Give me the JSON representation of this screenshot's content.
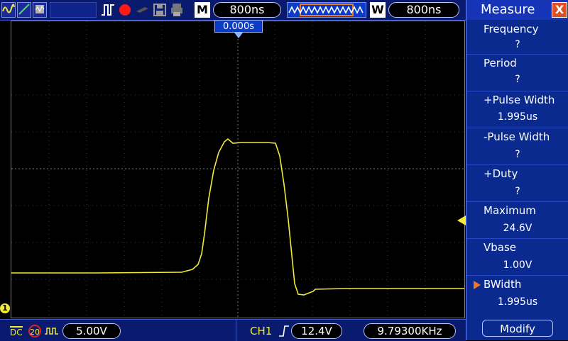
{
  "toolbar": {
    "mode_label": "M",
    "timebase": "800ns",
    "window_label": "W",
    "window_time": "800ns"
  },
  "screen": {
    "trigger_time": "0.000s",
    "channel_marker": "1"
  },
  "bottom": {
    "coupling": "DC",
    "bw_limit": "20",
    "ch_scale": "5.00V",
    "trigger_source": "CH1",
    "trigger_level": "12.4V",
    "frequency_readout": "9.79300KHz"
  },
  "measure": {
    "title": "Measure",
    "items": [
      {
        "label": "Frequency",
        "value": "?"
      },
      {
        "label": "Period",
        "value": "?"
      },
      {
        "label": "+Pulse Width",
        "value": "1.995us"
      },
      {
        "label": "-Pulse Width",
        "value": "?"
      },
      {
        "label": "+Duty",
        "value": "?"
      },
      {
        "label": "Maximum",
        "value": "24.6V"
      },
      {
        "label": "Vbase",
        "value": "1.00V"
      },
      {
        "label": "BWidth",
        "value": "1.995us"
      }
    ],
    "modify_label": "Modify"
  },
  "colors": {
    "trace": "#f2ea35",
    "panel": "#0a2a8f",
    "bar": "#0a1a6e",
    "accent": "#f07820"
  }
}
